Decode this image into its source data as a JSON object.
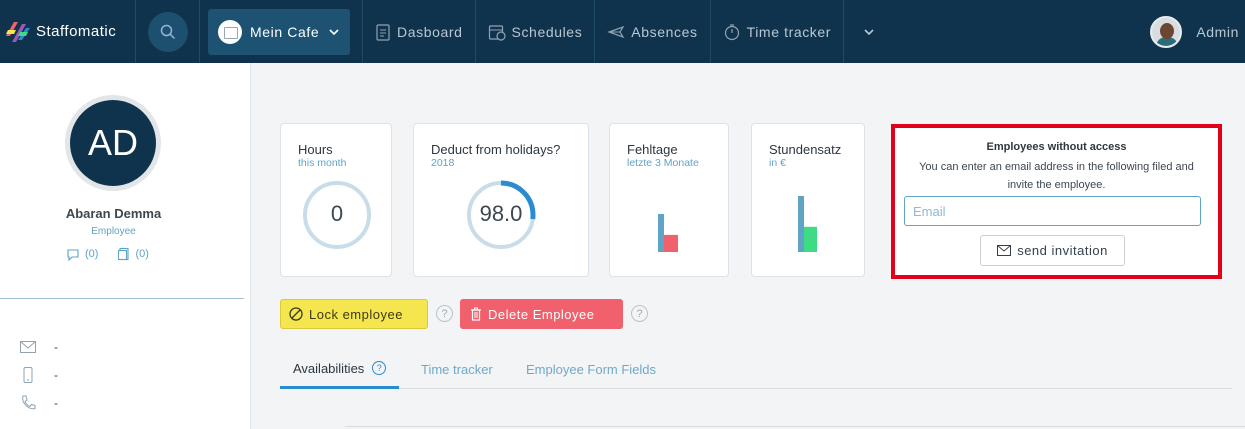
{
  "nav": {
    "brand": "Staffomatic",
    "location": "Mein Cafe",
    "items": [
      {
        "label": "Dasboard",
        "icon": "dashboard-icon"
      },
      {
        "label": "Schedules",
        "icon": "schedules-icon"
      },
      {
        "label": "Absences",
        "icon": "absences-icon"
      },
      {
        "label": "Time tracker",
        "icon": "stopwatch-icon"
      }
    ],
    "user": "Admin"
  },
  "profile": {
    "initials": "AD",
    "name": "Abaran Demma",
    "role": "Employee",
    "messages_count": "(0)",
    "documents_count": "(0)",
    "email": "-",
    "mobile": "-",
    "phone": "-"
  },
  "cards": {
    "hours": {
      "title": "Hours",
      "subtitle": "this month",
      "value": "0",
      "progress": 0
    },
    "holidays": {
      "title": "Deduct from holidays?",
      "subtitle": "2018",
      "value": "98.0",
      "progress": 0.27
    },
    "fehltage": {
      "title": "Fehltage",
      "subtitle": "letzte 3 Monate",
      "bars": [
        1.0,
        0.45
      ]
    },
    "stundensatz": {
      "title": "Stundensatz",
      "subtitle": "in €",
      "bars": [
        1.0,
        0.45
      ]
    }
  },
  "invite": {
    "title": "Employees without access",
    "text": "You can enter an email address in the following filed and invite the employee.",
    "email_placeholder": "Email",
    "button": "send invitation"
  },
  "actions": {
    "lock": "Lock employee",
    "delete": "Delete Employee"
  },
  "tabs": [
    {
      "label": "Availabilities",
      "active": true
    },
    {
      "label": "Time tracker",
      "active": false
    },
    {
      "label": "Employee Form Fields",
      "active": false
    }
  ],
  "colors": {
    "nav_bg": "#10334d",
    "accent": "#2a8bd0",
    "invite_border": "#e3001b",
    "lock_bg": "#f5e64f",
    "delete_bg": "#f0606d",
    "bar_blue": "#5fa3c7",
    "bar_red": "#f0606d",
    "bar_green": "#3ddc84"
  }
}
